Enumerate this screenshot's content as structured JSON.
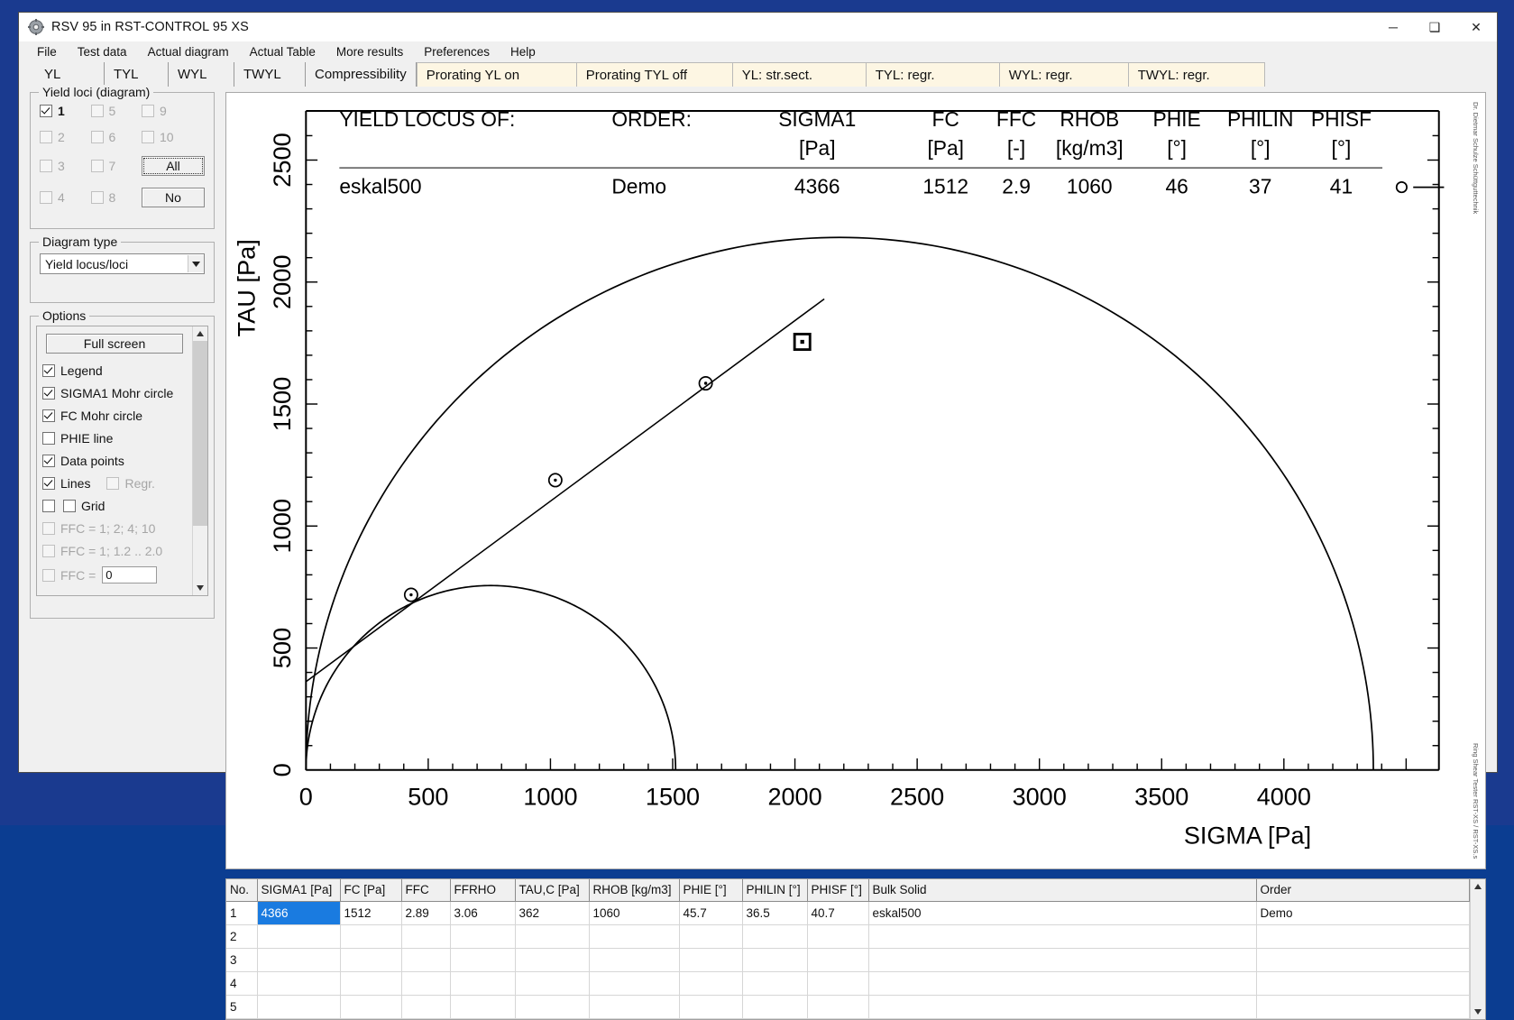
{
  "window": {
    "title": "RSV 95 in RST-CONTROL 95 XS",
    "icon": "app-gear-icon",
    "minimize": "─",
    "maximize": "❑",
    "close": "✕"
  },
  "menubar": [
    "File",
    "Test data",
    "Actual diagram",
    "Actual Table",
    "More results",
    "Preferences",
    "Help"
  ],
  "tabs": [
    {
      "label": "YL",
      "kind": "tab"
    },
    {
      "label": "TYL",
      "kind": "tab"
    },
    {
      "label": "WYL",
      "kind": "tab"
    },
    {
      "label": "TWYL",
      "kind": "tab"
    },
    {
      "label": "Compressibility",
      "kind": "tab"
    }
  ],
  "status_tabs": [
    {
      "label": "Prorating YL on"
    },
    {
      "label": "Prorating TYL off"
    },
    {
      "label": "YL: str.sect."
    },
    {
      "label": "TYL: regr."
    },
    {
      "label": "WYL: regr."
    },
    {
      "label": "TWYL: regr."
    }
  ],
  "yield_loci": {
    "title": "Yield loci (diagram)",
    "checkboxes": [
      {
        "label": "1",
        "checked": true,
        "enabled": true
      },
      {
        "label": "5",
        "checked": false,
        "enabled": false
      },
      {
        "label": "9",
        "checked": false,
        "enabled": false
      },
      {
        "label": "2",
        "checked": false,
        "enabled": false
      },
      {
        "label": "6",
        "checked": false,
        "enabled": false
      },
      {
        "label": "10",
        "checked": false,
        "enabled": false
      },
      {
        "label": "3",
        "checked": false,
        "enabled": false
      },
      {
        "label": "7",
        "checked": false,
        "enabled": false
      },
      {
        "label": "4",
        "checked": false,
        "enabled": false
      },
      {
        "label": "8",
        "checked": false,
        "enabled": false
      }
    ],
    "all_button": "All",
    "no_button": "No"
  },
  "diagram_type": {
    "title": "Diagram type",
    "selected": "Yield locus/loci"
  },
  "options": {
    "title": "Options",
    "full_screen_button": "Full screen",
    "items": [
      {
        "label": "Legend",
        "checked": true,
        "enabled": true
      },
      {
        "label": "SIGMA1 Mohr circle",
        "checked": true,
        "enabled": true
      },
      {
        "label": "FC Mohr circle",
        "checked": true,
        "enabled": true
      },
      {
        "label": "PHIE line",
        "checked": false,
        "enabled": true
      },
      {
        "label": "Data points",
        "checked": true,
        "enabled": true
      },
      {
        "label": "Lines",
        "checked": true,
        "enabled": true
      },
      {
        "label": "Regr.",
        "checked": false,
        "enabled": false
      },
      {
        "label": "Grid",
        "checked": false,
        "enabled": true
      },
      {
        "label": "FFC = 1; 2; 4; 10",
        "checked": false,
        "enabled": false
      },
      {
        "label": "FFC = 1; 1.2 .. 2.0",
        "checked": false,
        "enabled": false
      },
      {
        "label": "FFC =",
        "checked": false,
        "enabled": false
      }
    ],
    "ffc_value": "0",
    "scroll_up": "⌃",
    "scroll_down": "⌄"
  },
  "chart_data": {
    "type": "scatter",
    "title": "",
    "xlabel": "SIGMA [Pa]",
    "ylabel": "TAU [Pa]",
    "xlim": [
      0,
      4550
    ],
    "ylim": [
      0,
      2680
    ],
    "xticks": [
      0,
      500,
      1000,
      1500,
      2000,
      2500,
      3000,
      3500,
      4000
    ],
    "yticks": [
      0,
      500,
      1000,
      1500,
      2000,
      2500
    ],
    "grid": false,
    "legend": {
      "headers_row1": [
        "YIELD LOCUS OF:",
        "ORDER:",
        "SIGMA1",
        "FC",
        "FFC",
        "RHOB",
        "PHIE",
        "PHILIN",
        "PHISF"
      ],
      "headers_row2": [
        "",
        "",
        "[Pa]",
        "[Pa]",
        "[-]",
        "[kg/m3]",
        "[°]",
        "[°]",
        "[°]"
      ],
      "rows": [
        {
          "bulk_solid": "eskal500",
          "order": "Demo",
          "sigma1": "4366",
          "fc": "1512",
          "ffc": "2.9",
          "rhob": "1060",
          "phie": "46",
          "philin": "37",
          "phisf": "41"
        }
      ]
    },
    "yield_locus_points": [
      {
        "sigma": 430,
        "tau": 718
      },
      {
        "sigma": 1020,
        "tau": 1188
      },
      {
        "sigma": 1635,
        "tau": 1585
      }
    ],
    "preshear_point": {
      "sigma": 2030,
      "tau": 1755
    },
    "sigma1_mohr_circle": {
      "sigma_min": 0,
      "sigma_max": 4366,
      "center": 2183,
      "radius": 2183
    },
    "fc_mohr_circle": {
      "sigma_min": 0,
      "sigma_max": 1512,
      "center": 756,
      "radius": 756
    },
    "yield_locus_line": {
      "tau_c": 362,
      "philin_deg": 36.5
    },
    "right_caption_top": "Dr. Dietmar Schulze Schüttguttechnik",
    "right_caption_bottom": "Ring Shear Tester RST-XS / RST-XS.s"
  },
  "table": {
    "columns": [
      "No.",
      "SIGMA1 [Pa]",
      "FC [Pa]",
      "FFC",
      "FFRHO",
      "TAU,C [Pa]",
      "RHOB [kg/m3]",
      "PHIE [°]",
      "PHILIN [°]",
      "PHISF [°]",
      "Bulk Solid",
      "Order"
    ],
    "rows": [
      [
        "1",
        "4366",
        "1512",
        "2.89",
        "3.06",
        "362",
        "1060",
        "45.7",
        "36.5",
        "40.7",
        "eskal500",
        "Demo"
      ],
      [
        "2",
        "",
        "",
        "",
        "",
        "",
        "",
        "",
        "",
        "",
        "",
        ""
      ],
      [
        "3",
        "",
        "",
        "",
        "",
        "",
        "",
        "",
        "",
        "",
        "",
        ""
      ],
      [
        "4",
        "",
        "",
        "",
        "",
        "",
        "",
        "",
        "",
        "",
        "",
        ""
      ],
      [
        "5",
        "",
        "",
        "",
        "",
        "",
        "",
        "",
        "",
        "",
        "",
        ""
      ]
    ],
    "selected_cell": {
      "row": 0,
      "col": 1
    },
    "scroll_up": "⌃",
    "scroll_down": "⌄"
  }
}
